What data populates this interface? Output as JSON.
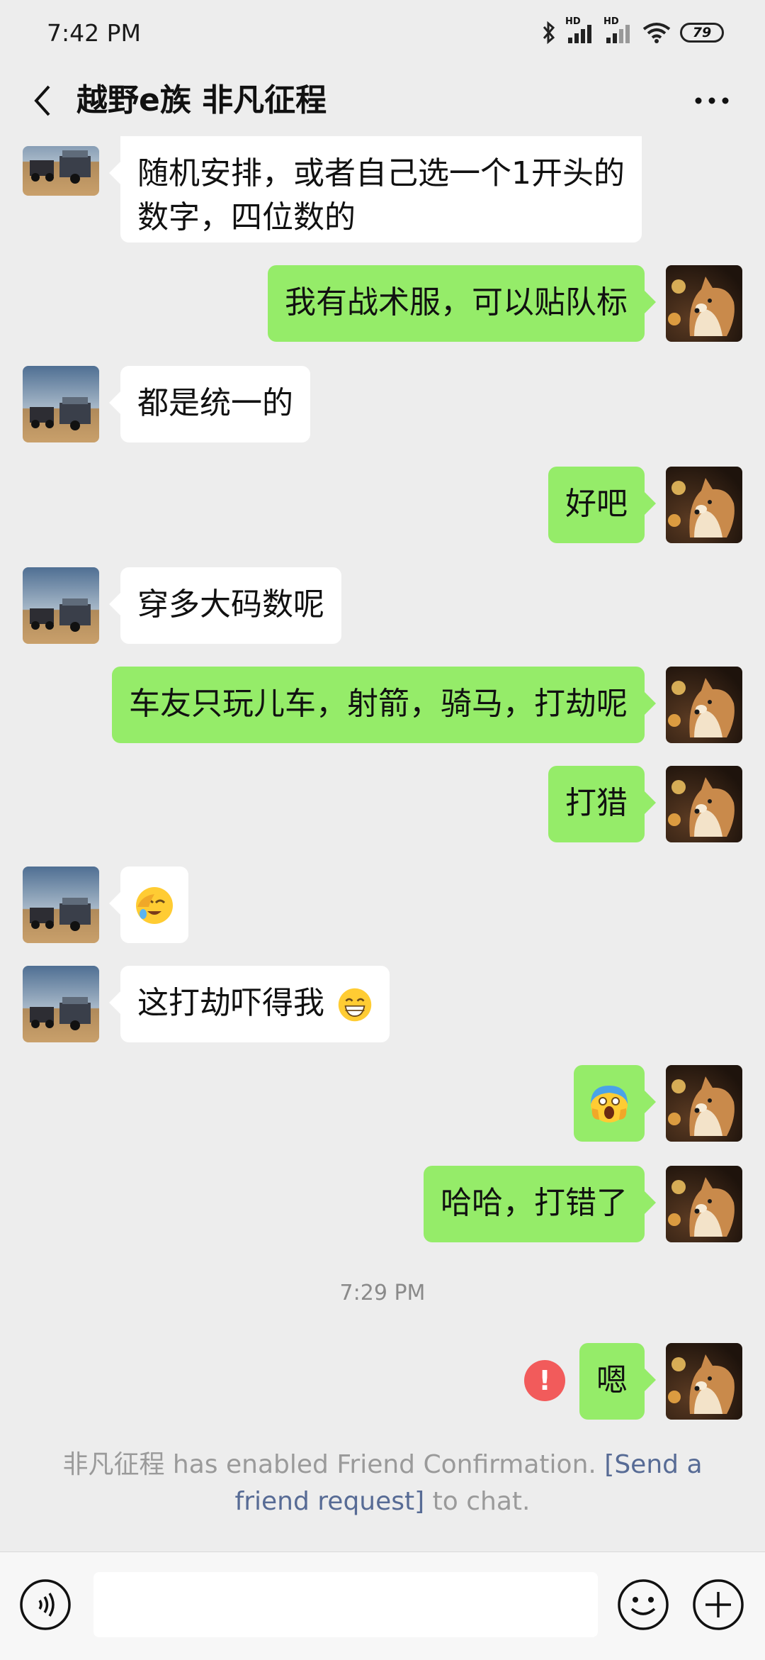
{
  "status": {
    "time": "7:42 PM",
    "signal1_label": "HD",
    "signal2_label": "HD",
    "battery": "79"
  },
  "header": {
    "title": "越野e族 非凡征程"
  },
  "messages": [
    {
      "side": "left",
      "lines": [
        "随机安排，或者自己选一个1开头的",
        "数字，四位数的"
      ]
    },
    {
      "side": "right",
      "text": "我有战术服，可以贴队标"
    },
    {
      "side": "left",
      "text": "都是统一的"
    },
    {
      "side": "right",
      "text": "好吧"
    },
    {
      "side": "left",
      "text": "穿多大码数呢"
    },
    {
      "side": "right",
      "text": "车友只玩儿车，射箭，骑马，打劫呢"
    },
    {
      "side": "right",
      "text": "打猎"
    },
    {
      "side": "left",
      "emoji": "facepalm-emoji"
    },
    {
      "side": "left",
      "text": "这打劫吓得我",
      "emoji": "grin-emoji"
    },
    {
      "side": "right",
      "emoji": "scream-emoji"
    },
    {
      "side": "right",
      "text": "哈哈，打错了"
    },
    {
      "side": "right",
      "text": "嗯",
      "failed": true
    }
  ],
  "timestamp": "7:29 PM",
  "error_mark": "!",
  "system_note": {
    "prefix": "非凡征程 has enabled Friend Confirmation. ",
    "link": "[Send a friend request]",
    "suffix": " to chat."
  },
  "input": {
    "value": "",
    "placeholder": ""
  },
  "colors": {
    "background": "#ededed",
    "outgoing_bubble": "#95ec69",
    "incoming_bubble": "#ffffff",
    "link": "#576b95",
    "error": "#f25b5b"
  }
}
